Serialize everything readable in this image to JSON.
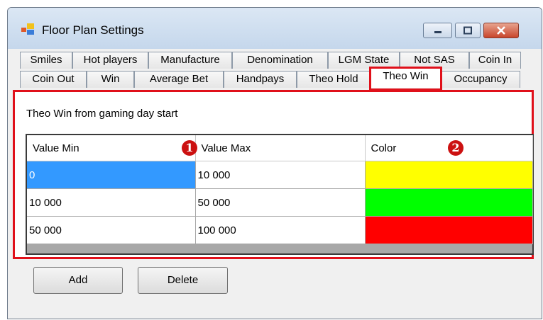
{
  "window": {
    "title": "Floor Plan Settings",
    "icon": "floor-plan-app-icon"
  },
  "tabs_row1": [
    "Smiles",
    "Hot players",
    "Manufacture",
    "Denomination",
    "LGM State",
    "Not SAS",
    "Coin In"
  ],
  "tabs_row2": [
    "Coin Out",
    "Win",
    "Average Bet",
    "Handpays",
    "Theo Hold",
    "Theo Win",
    "Occupancy"
  ],
  "selected_tab": "Theo Win",
  "panel": {
    "description": "Theo Win from gaming day start"
  },
  "grid": {
    "headers": [
      "Value Min",
      "Value Max",
      "Color"
    ],
    "rows": [
      {
        "min": "0",
        "max": "10 000",
        "color": "#ffff00"
      },
      {
        "min": "10 000",
        "max": "50 000",
        "color": "#00ff00"
      },
      {
        "min": "50 000",
        "max": "100 000",
        "color": "#ff0000"
      }
    ]
  },
  "callouts": [
    "1",
    "2"
  ],
  "buttons": {
    "add": "Add",
    "delete": "Delete"
  },
  "colors": {
    "highlight": "#e0101a",
    "selection": "#3399ff",
    "badge": "#cc1111"
  }
}
